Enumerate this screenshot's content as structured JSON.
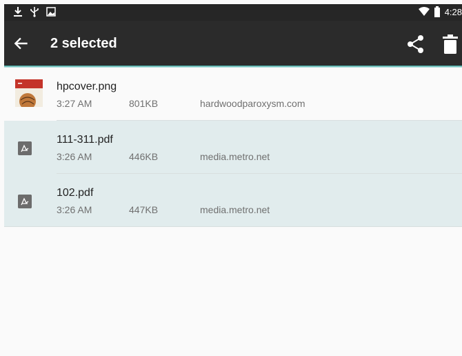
{
  "status_bar": {
    "time": "4:28",
    "left_icons": [
      "download-icon",
      "usb-icon",
      "image-icon"
    ],
    "right_icons": [
      "wifi-icon",
      "battery-icon"
    ]
  },
  "app_bar": {
    "title": "2 selected",
    "back_icon": "arrow-back-icon",
    "actions": [
      "share-icon",
      "delete-icon"
    ],
    "background": "#2b2b2b",
    "accent": "#35a39c"
  },
  "downloads": [
    {
      "name": "hpcover.png",
      "time": "3:27 AM",
      "size": "801KB",
      "domain": "hardwoodparoxysm.com",
      "selected": false,
      "icon": "image-thumbnail"
    },
    {
      "name": "111-311.pdf",
      "time": "3:26 AM",
      "size": "446KB",
      "domain": "media.metro.net",
      "selected": true,
      "icon": "pdf-icon"
    },
    {
      "name": "102.pdf",
      "time": "3:26 AM",
      "size": "447KB",
      "domain": "media.metro.net",
      "selected": true,
      "icon": "pdf-icon"
    }
  ],
  "colors": {
    "selected_row": "#e1eced",
    "divider": "#d8dfdf"
  }
}
